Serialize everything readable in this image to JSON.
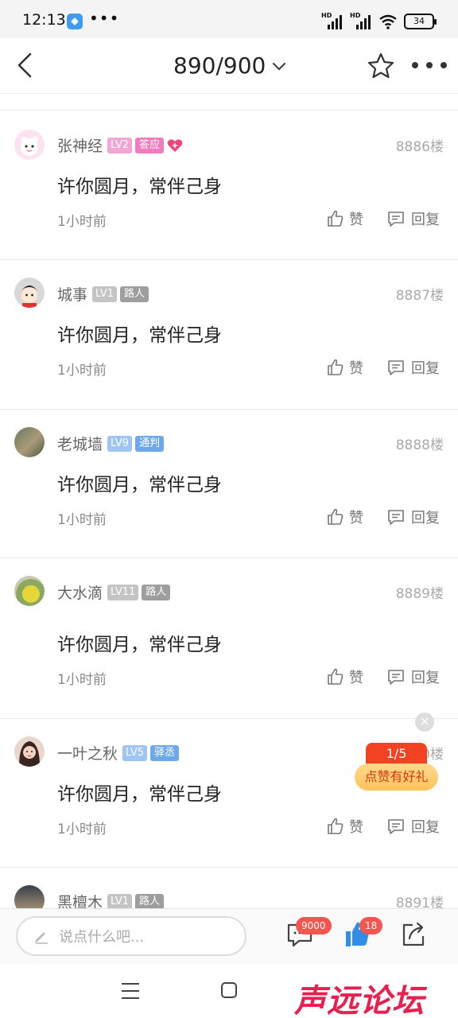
{
  "status_bar": {
    "time": "12:13",
    "more": "•••",
    "signal_label_1": "HD",
    "signal_label_2": "HD",
    "battery": "34"
  },
  "header": {
    "page_indicator": "890/900"
  },
  "colors": {
    "lv_pink": "#f3a6d5",
    "lv_gray": "#c4c4c4",
    "lv_blue": "#9fc5f2",
    "role_pink": "#f07bbd",
    "role_gray": "#9e9e9e",
    "role_blue": "#6da8ea"
  },
  "posts": [
    {
      "username": "张神经",
      "level": "LV2",
      "role": "答应",
      "has_heart": true,
      "floor": "8886楼",
      "content": "许你圆月，常伴己身",
      "time": "1小时前",
      "like_label": "赞",
      "reply_label": "回复"
    },
    {
      "username": "城事",
      "level": "LV1",
      "role": "路人",
      "has_heart": false,
      "floor": "8887楼",
      "content": "许你圆月，常伴己身",
      "time": "1小时前",
      "like_label": "赞",
      "reply_label": "回复"
    },
    {
      "username": "老城墙",
      "level": "LV9",
      "role": "通判",
      "has_heart": false,
      "floor": "8888楼",
      "content": "许你圆月，常伴己身",
      "time": "1小时前",
      "like_label": "赞",
      "reply_label": "回复"
    },
    {
      "username": "大水滴",
      "level": "LV11",
      "role": "路人",
      "has_heart": false,
      "floor": "8889楼",
      "content": "许你圆月，常伴己身",
      "time": "1小时前",
      "like_label": "赞",
      "reply_label": "回复"
    },
    {
      "username": "一叶之秋",
      "level": "LV5",
      "role": "驿丞",
      "has_heart": false,
      "floor": "8890楼",
      "content": "许你圆月，常伴己身",
      "time": "1小时前",
      "like_label": "赞",
      "reply_label": "回复"
    },
    {
      "username": "黑檀木",
      "level": "LV1",
      "role": "路人",
      "has_heart": false,
      "floor": "8891楼"
    }
  ],
  "promo": {
    "progress": "1/5",
    "label": "点赞有好礼",
    "close": "×"
  },
  "bottom_bar": {
    "input_placeholder": "说点什么吧...",
    "comment_count": "9000",
    "like_count": "18"
  },
  "watermark": "声远论坛"
}
